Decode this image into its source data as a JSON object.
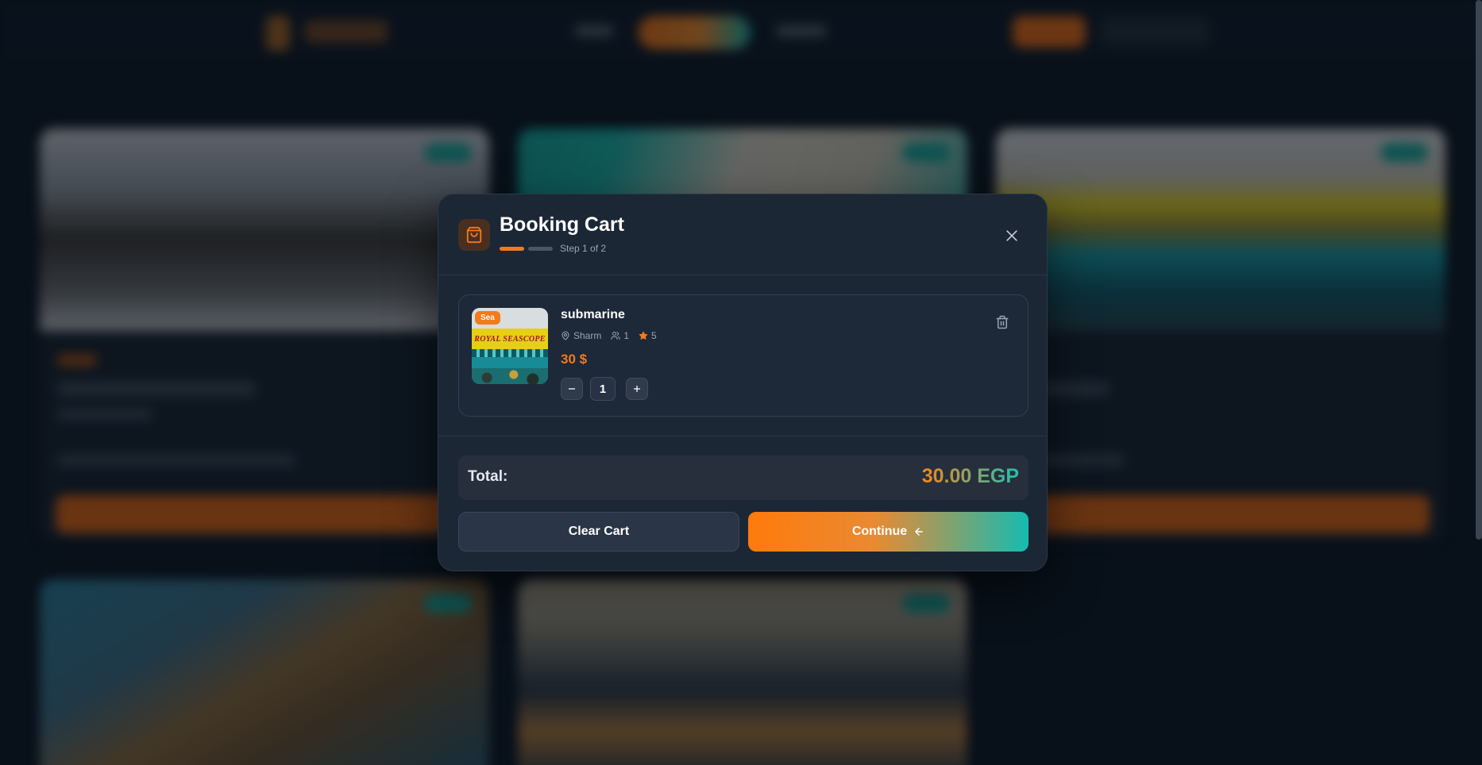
{
  "modal": {
    "title": "Booking Cart",
    "step_label": "Step 1 of 2",
    "progress": {
      "current_step": 1,
      "total_steps": 2
    }
  },
  "cart": {
    "items": [
      {
        "badge": "Sea",
        "name": "submarine",
        "location": "Sharm",
        "people": "1",
        "rating": "5",
        "price": "30 $",
        "quantity": "1",
        "thumbnail_sign_text": "ROYAL SEASCOPE"
      }
    ]
  },
  "summary": {
    "total_label": "Total:",
    "total_value": "30.00 EGP"
  },
  "actions": {
    "clear_label": "Clear Cart",
    "continue_label": "Continue"
  },
  "colors": {
    "accent_orange": "#f47a1a",
    "accent_teal": "#15bcb0",
    "modal_bg": "#1c2736",
    "page_bg": "#0b1420"
  },
  "icons": {
    "header": "shopping-bag-icon",
    "close": "close-icon",
    "delete": "trash-icon",
    "location": "map-pin-icon",
    "people": "users-icon",
    "rating": "star-icon",
    "continue": "arrow-left-icon"
  }
}
